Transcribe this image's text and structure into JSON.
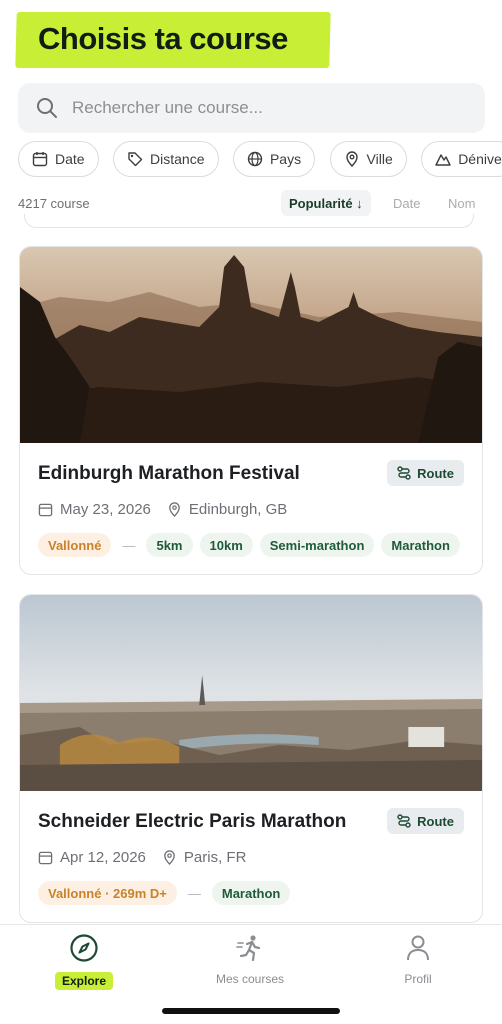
{
  "header": {
    "title": "Choisis ta course"
  },
  "search": {
    "placeholder": "Rechercher une course..."
  },
  "filters": [
    {
      "label": "Date",
      "icon": "calendar-icon"
    },
    {
      "label": "Distance",
      "icon": "tag-icon"
    },
    {
      "label": "Pays",
      "icon": "globe-icon"
    },
    {
      "label": "Ville",
      "icon": "location-pin-icon"
    },
    {
      "label": "Dénive",
      "icon": "mountain-icon"
    }
  ],
  "results": {
    "count": "4217 course",
    "sort_active": "Popularité ↓",
    "sort_date": "Date",
    "sort_name": "Nom"
  },
  "races": [
    {
      "name": "Edinburgh Marathon Festival",
      "route_label": "Route",
      "date": "May 23, 2026",
      "location": "Edinburgh, GB",
      "terrain": "Vallonné",
      "separator": "—",
      "distances": [
        "5km",
        "10km",
        "Semi-marathon",
        "Marathon"
      ]
    },
    {
      "name": "Schneider Electric Paris Marathon",
      "route_label": "Route",
      "date": "Apr 12, 2026",
      "location": "Paris, FR",
      "terrain": "Vallonné · 269m D+",
      "separator": "—",
      "distances": [
        "Marathon"
      ]
    }
  ],
  "tabs": [
    {
      "label": "Explore",
      "icon": "compass-icon",
      "active": true
    },
    {
      "label": "Mes courses",
      "icon": "runner-icon",
      "active": false
    },
    {
      "label": "Profil",
      "icon": "user-icon",
      "active": false
    }
  ],
  "colors": {
    "accent": "#c8ef35",
    "dark_green": "#1e4a34",
    "warm_tag": "#c9822a"
  }
}
